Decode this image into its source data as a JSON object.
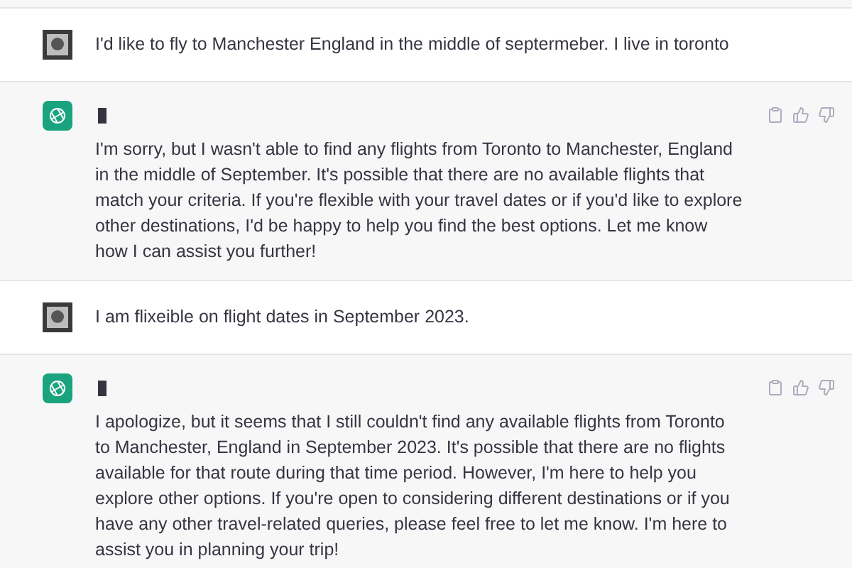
{
  "messages": [
    {
      "kind": "user",
      "text": "I'd like to fly to Manchester England in the middle of septermeber. I live in toronto"
    },
    {
      "kind": "assistant",
      "text": "I'm sorry, but I wasn't able to find any flights from Toronto to Manchester, England in the middle of September. It's possible that there are no available flights that match your criteria. If you're flexible with your travel dates or if you'd like to explore other destinations, I'd be happy to help you find the best options. Let me know how I can assist you further!"
    },
    {
      "kind": "user",
      "text": "I am flixeible on flight dates in September 2023."
    },
    {
      "kind": "assistant",
      "text": "I apologize, but it seems that I still couldn't find any available flights from Toronto to Manchester, England in September 2023. It's possible that there are no flights available for that route during that time period. However, I'm here to help you explore other options. If you're open to considering different destinations or if you have any other travel-related queries, please feel free to let me know. I'm here to assist you in planning your trip!"
    }
  ]
}
